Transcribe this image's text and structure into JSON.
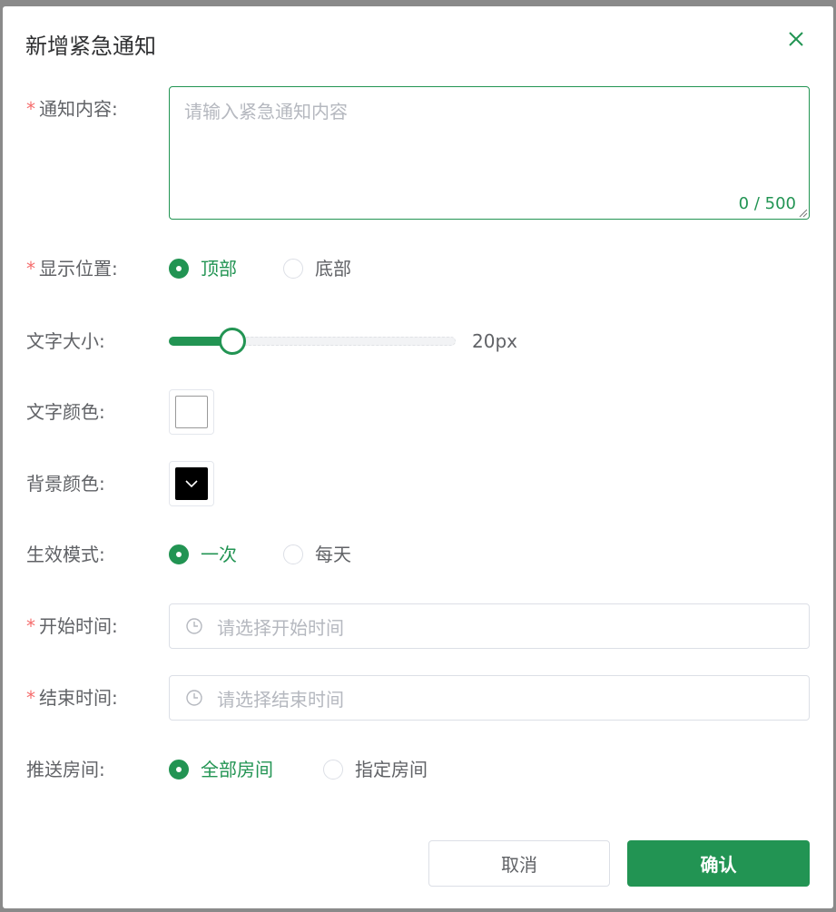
{
  "dialog": {
    "title": "新增紧急通知",
    "close_icon": "close-icon"
  },
  "form": {
    "content": {
      "label": "通知内容:",
      "required_mark": "*",
      "placeholder": "请输入紧急通知内容",
      "counter": "0 / 500",
      "value": ""
    },
    "position": {
      "label": "显示位置:",
      "required_mark": "*",
      "options": [
        "顶部",
        "底部"
      ],
      "selected": "顶部"
    },
    "font_size": {
      "label": "文字大小:",
      "value_text": "20px",
      "level": 0.22
    },
    "text_color": {
      "label": "文字颜色:",
      "color": "#ffffff"
    },
    "bg_color": {
      "label": "背景颜色:",
      "color": "#000000",
      "icon": "chevron-down-icon"
    },
    "mode": {
      "label": "生效模式:",
      "options": [
        "一次",
        "每天"
      ],
      "selected": "一次"
    },
    "start_time": {
      "label": "开始时间:",
      "required_mark": "*",
      "placeholder": "请选择开始时间",
      "icon": "clock-icon"
    },
    "end_time": {
      "label": "结束时间:",
      "required_mark": "*",
      "placeholder": "请选择结束时间",
      "icon": "clock-icon"
    },
    "rooms": {
      "label": "推送房间:",
      "options": [
        "全部房间",
        "指定房间"
      ],
      "selected": "全部房间"
    }
  },
  "footer": {
    "cancel_label": "取消",
    "confirm_label": "确认"
  },
  "colors": {
    "accent": "#229453",
    "required": "#f56c6c"
  }
}
